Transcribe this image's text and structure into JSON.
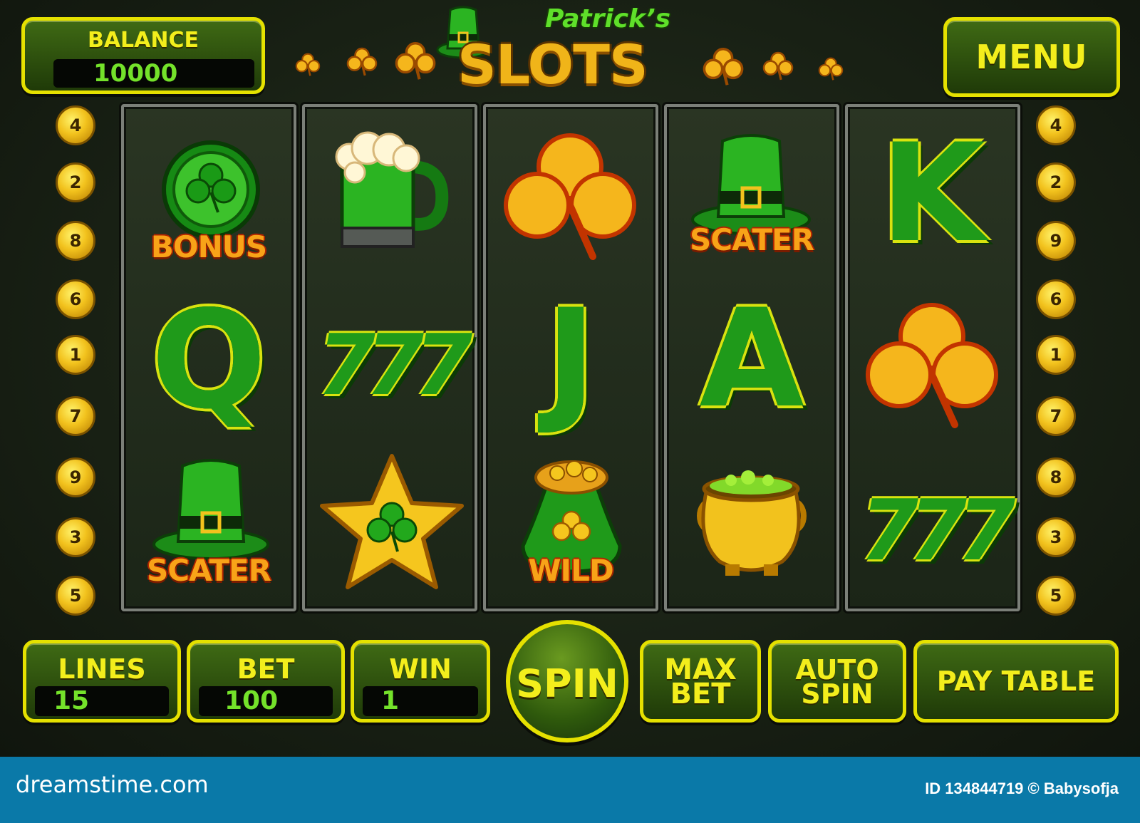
{
  "title": {
    "script": "Patrick’s",
    "main": "SLOTS"
  },
  "balance": {
    "label": "BALANCE",
    "value": "10000"
  },
  "menu": {
    "label": "MENU"
  },
  "line_numbers": {
    "left": [
      "4",
      "2",
      "8",
      "6",
      "1",
      "7",
      "9",
      "3",
      "5"
    ],
    "right": [
      "4",
      "2",
      "9",
      "6",
      "1",
      "7",
      "8",
      "3",
      "5"
    ]
  },
  "reels": [
    [
      {
        "symbol": "bonus-coin",
        "label": "BONUS"
      },
      {
        "symbol": "letter",
        "label": "Q"
      },
      {
        "symbol": "leprechaun-hat",
        "label": "SCATER"
      }
    ],
    [
      {
        "symbol": "beer-mug",
        "label": ""
      },
      {
        "symbol": "sevens",
        "label": "777"
      },
      {
        "symbol": "clover-star",
        "label": ""
      }
    ],
    [
      {
        "symbol": "gold-clover",
        "label": ""
      },
      {
        "symbol": "letter",
        "label": "J"
      },
      {
        "symbol": "coin-bag",
        "label": "WILD"
      }
    ],
    [
      {
        "symbol": "leprechaun-hat",
        "label": "SCATER"
      },
      {
        "symbol": "letter",
        "label": "A"
      },
      {
        "symbol": "gold-pot",
        "label": ""
      }
    ],
    [
      {
        "symbol": "letter",
        "label": "K"
      },
      {
        "symbol": "gold-clover",
        "label": ""
      },
      {
        "symbol": "sevens",
        "label": "777"
      }
    ]
  ],
  "controls": {
    "lines": {
      "label": "LINES",
      "value": "15"
    },
    "bet": {
      "label": "BET",
      "value": "100"
    },
    "win": {
      "label": "WIN",
      "value": "1"
    },
    "spin": "SPIN",
    "max_bet": [
      "MAX",
      "BET"
    ],
    "auto_spin": [
      "AUTO",
      "SPIN"
    ],
    "pay_table": "PAY TABLE"
  },
  "footer": {
    "site": "dreamstime.com",
    "credit": "ID 134844719 © Babysofja"
  },
  "colors": {
    "panel_border": "#e5e100",
    "panel_fill": "#2f5a0c",
    "value_text": "#74e22a",
    "gold": "#f2c21d",
    "footer_bg": "#0a79a8"
  }
}
